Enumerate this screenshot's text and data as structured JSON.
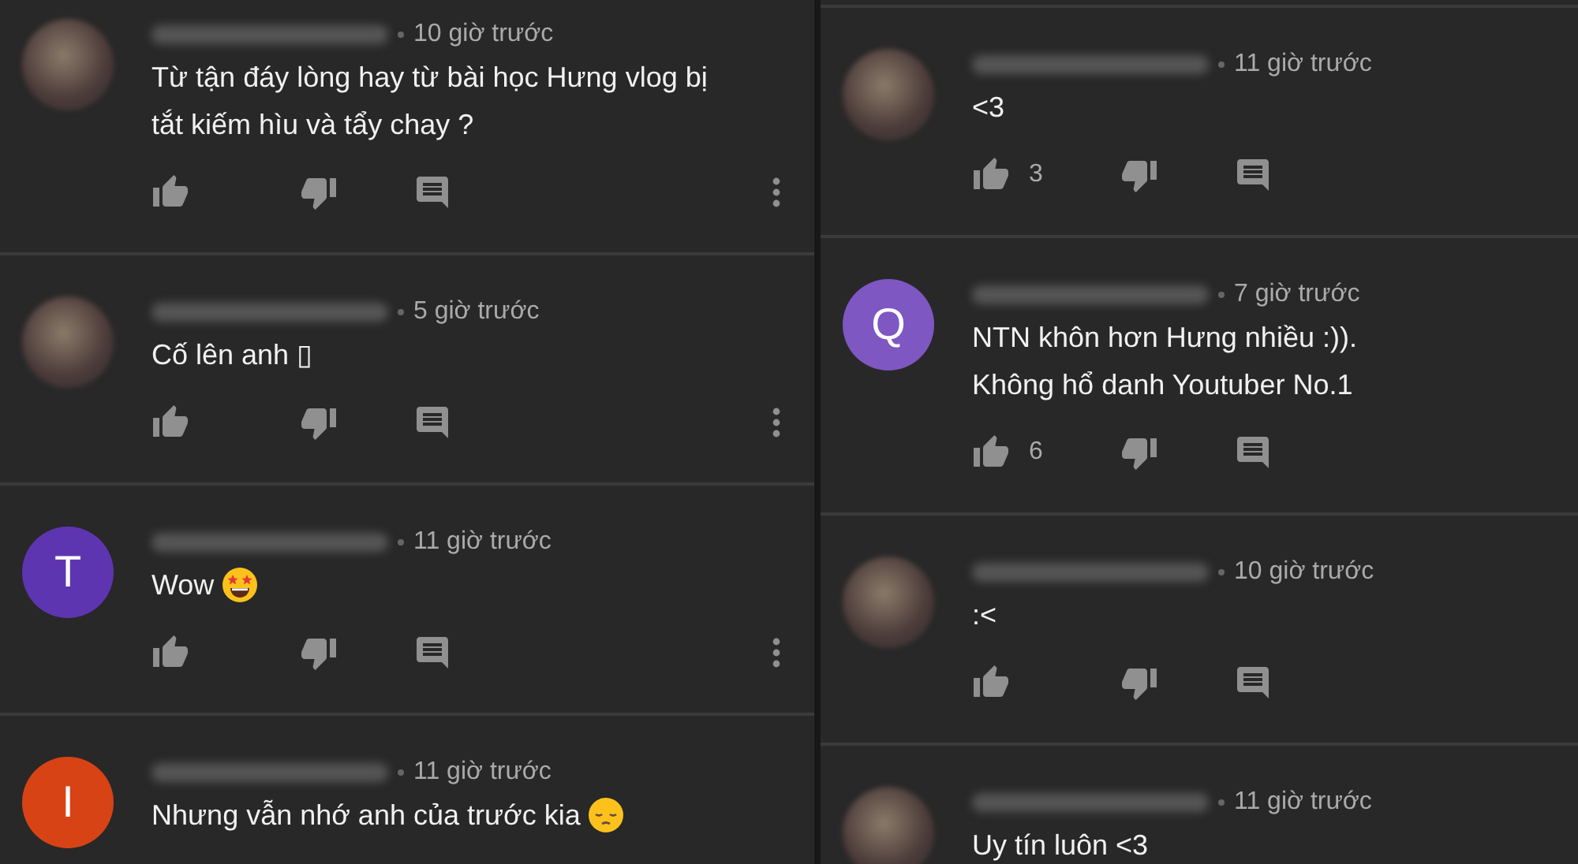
{
  "panels": [
    {
      "comments": [
        {
          "avatar": {
            "kind": "photo"
          },
          "time": "10 giờ trước",
          "text": "Từ tận đáy lòng hay từ bài học Hưng vlog bị tắt kiếm hìu và tẩy chay ?",
          "actions": true,
          "menu": true
        },
        {
          "avatar": {
            "kind": "photo"
          },
          "time": "5 giờ trước",
          "text": "Cố lên anh ▯",
          "actions": true,
          "menu": true
        },
        {
          "avatar": {
            "kind": "letter",
            "letter": "T",
            "color": "#5e35b1"
          },
          "time": "11 giờ trước",
          "text": "Wow",
          "emoji": {
            "kind": "star-eyes"
          },
          "actions": true,
          "menu": true
        },
        {
          "avatar": {
            "kind": "letter",
            "letter": "I",
            "color": "#d84315"
          },
          "time": "11 giờ trước",
          "text": "Nhưng vẫn nhớ anh của trước kia",
          "emoji": {
            "kind": "pensive"
          },
          "actions": false
        }
      ]
    },
    {
      "comments": [
        {
          "avatar": {
            "kind": "photo"
          },
          "time": "11 giờ trước",
          "text": "<3",
          "likes": "3",
          "actions": true,
          "menu": false
        },
        {
          "avatar": {
            "kind": "letter",
            "letter": "Q",
            "color": "#7e57c2"
          },
          "time": "7 giờ trước",
          "text": "NTN khôn hơn Hưng  nhiều :)). Không hổ danh Youtuber No.1",
          "likes": "6",
          "actions": true,
          "menu": false
        },
        {
          "avatar": {
            "kind": "photo"
          },
          "time": "10 giờ trước",
          "text": ":<",
          "actions": true,
          "menu": false
        },
        {
          "avatar": {
            "kind": "photo"
          },
          "time": "11 giờ trước",
          "text": "Uy tín luôn <3",
          "actions": false
        }
      ]
    }
  ]
}
